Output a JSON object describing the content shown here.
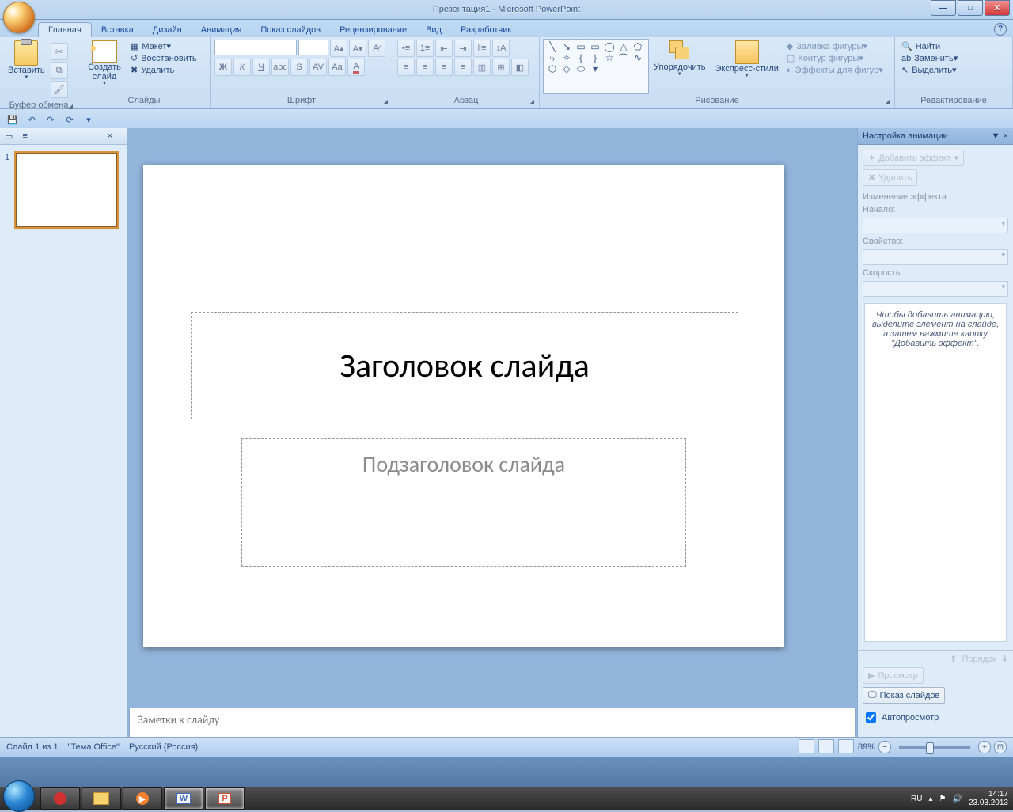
{
  "title": "Презентация1 - Microsoft PowerPoint",
  "win_controls": {
    "min": "—",
    "max": "□",
    "close": "X"
  },
  "tabs": [
    "Главная",
    "Вставка",
    "Дизайн",
    "Анимация",
    "Показ слайдов",
    "Рецензирование",
    "Вид",
    "Разработчик"
  ],
  "active_tab": 0,
  "ribbon": {
    "clipboard": {
      "label": "Буфер обмена",
      "paste": "Вставить"
    },
    "slides": {
      "label": "Слайды",
      "new": "Создать слайд",
      "layout": "Макет",
      "reset": "Восстановить",
      "delete": "Удалить"
    },
    "font": {
      "label": "Шрифт"
    },
    "paragraph": {
      "label": "Абзац"
    },
    "drawing": {
      "label": "Рисование",
      "arrange": "Упорядочить",
      "quick": "Экспресс-стили",
      "fill": "Заливка фигуры",
      "outline": "Контур фигуры",
      "effects": "Эффекты для фигур"
    },
    "editing": {
      "label": "Редактирование",
      "find": "Найти",
      "replace": "Заменить",
      "select": "Выделить"
    }
  },
  "thumb_tabs": {
    "slides_icon": "▭",
    "outline_icon": "≡",
    "close": "×"
  },
  "thumb_number": "1",
  "slide": {
    "title": "Заголовок слайда",
    "subtitle": "Подзаголовок слайда"
  },
  "notes_placeholder": "Заметки к слайду",
  "animation_pane": {
    "title": "Настройка анимации",
    "add_effect": "Добавить эффект",
    "remove": "Удалить",
    "change": "Изменение эффекта",
    "start": "Начало:",
    "property": "Свойство:",
    "speed": "Скорость:",
    "hint": "Чтобы добавить анимацию, выделите элемент на слайде, а затем нажмите кнопку \"Добавить эффект\".",
    "order": "Порядок",
    "preview": "Просмотр",
    "slideshow": "Показ слайдов",
    "autopreview": "Автопросмотр"
  },
  "status": {
    "slide": "Слайд 1 из 1",
    "theme": "\"Тема Office\"",
    "lang": "Русский (Россия)",
    "zoom": "89%"
  },
  "tray": {
    "lang": "RU",
    "time": "14:17",
    "date": "23.03.2013"
  }
}
